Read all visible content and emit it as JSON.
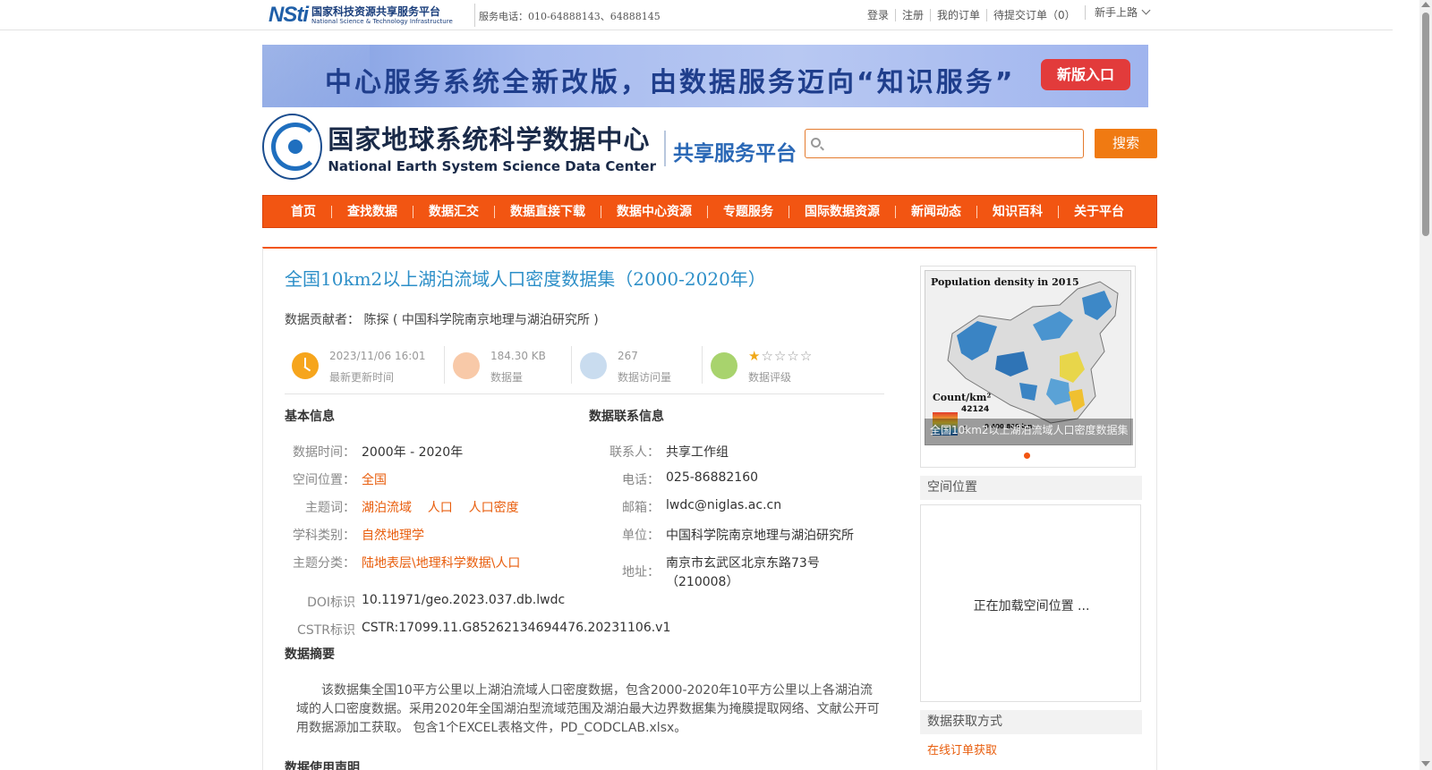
{
  "topbar": {
    "nsti_mark": "NSti",
    "nsti_cn": "国家科技资源共享服务平台",
    "nsti_en": "National Science & Technology Infrastructure",
    "service_phone": "服务电话：010-64888143、64888145",
    "links": [
      "登录",
      "注册",
      "我的订单",
      "待提交订单（0）"
    ],
    "newbie": "新手上路"
  },
  "banner": {
    "text": "中心服务系统全新改版，由数据服务迈向“知识服务”",
    "button": "新版入口"
  },
  "header": {
    "center_cn": "国家地球系统科学数据中心",
    "center_en": "National Earth System Science Data Center",
    "platform": "共享服务平台",
    "search_placeholder": "",
    "search_button": "搜索"
  },
  "nav": [
    "首页",
    "查找数据",
    "数据汇交",
    "数据直接下载",
    "数据中心资源",
    "专题服务",
    "国际数据资源",
    "新闻动态",
    "知识百科",
    "关于平台"
  ],
  "dataset": {
    "title": "全国10km2以上湖泊流域人口密度数据集（2000-2020年）",
    "contributor_label": "数据贡献者：",
    "contributor": "陈探 ( 中国科学院南京地理与湖泊研究所 )",
    "stats": {
      "update_time": "2023/11/06 16:01",
      "update_time_label": "最新更新时间",
      "size": "184.30 KB",
      "size_label": "数据量",
      "visits": "267",
      "visits_label": "数据访问量",
      "rating_label": "数据评级",
      "rating": 1,
      "rating_max": 5
    }
  },
  "basic_info": {
    "title": "基本信息",
    "rows": [
      {
        "k": "数据时间：",
        "v": "2000年 - 2020年"
      },
      {
        "k": "空间位置：",
        "v": "全国"
      },
      {
        "k": "主题词：",
        "v": "湖泊流域    人口    人口密度"
      },
      {
        "k": "学科类别：",
        "v": "自然地理学"
      },
      {
        "k": "主题分类：",
        "v": "陆地表层\\地理科学数据\\人口"
      },
      {
        "k": "DOI标识",
        "v": "10.11971/geo.2023.037.db.lwdc"
      },
      {
        "k": "CSTR标识",
        "v": "CSTR:17099.11.G85262134694476.20231106.v1"
      }
    ]
  },
  "contact_info": {
    "title": "数据联系信息",
    "rows": [
      {
        "k": "联系人：",
        "v": "共享工作组"
      },
      {
        "k": "电话：",
        "v": "025-86882160"
      },
      {
        "k": "邮箱：",
        "v": "lwdc@niglas.ac.cn"
      },
      {
        "k": "单位：",
        "v": "中国科学院南京地理与湖泊研究所"
      },
      {
        "k": "地址：",
        "v": "南京市玄武区北京东路73号",
        "v2": "（210008）"
      }
    ]
  },
  "abstract": {
    "title": "数据摘要",
    "text": "该数据集全国10平方公里以上湖泊流域人口密度数据，包含2000-2020年10平方公里以上各湖泊流域的人口密度数据。采用2020年全国湖泊型流域范围及湖泊最大边界数据集为掩膜提取网络、文献公开可用数据源加工获取。 包含1个EXCEL表格文件，PD_CODCLAB.xlsx。"
  },
  "usage_title": "数据使用声明",
  "sidebar": {
    "thumb": {
      "map_title": "Population density in 2015",
      "legend_label": "Count/km²",
      "legend_max": "42124",
      "legend_min": "0",
      "scale": "0  400 800 km",
      "caption": "全国10km2以上湖泊流域人口密度数据集（2000-2020年）"
    },
    "spatial_title": "空间位置",
    "spatial_loading": "正在加载空间位置 ...",
    "access_title": "数据获取方式",
    "access_link": "在线订单获取"
  },
  "colors": {
    "nav_bg": "#f25512",
    "title_blue": "#2d8fc8",
    "accent_orange": "#e85d0c",
    "banner_button": "#e23b3b"
  }
}
